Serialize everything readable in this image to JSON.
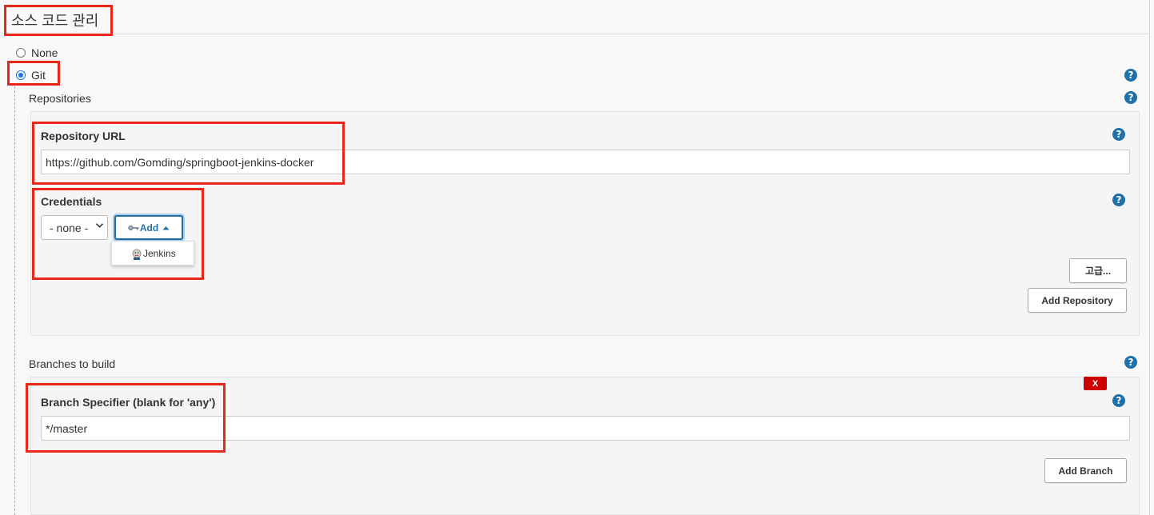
{
  "scm": {
    "title": "소스 코드 관리",
    "options": [
      {
        "label": "None",
        "selected": false
      },
      {
        "label": "Git",
        "selected": true
      }
    ]
  },
  "help_symbol": "?",
  "repositories": {
    "label": "Repositories",
    "repository_url_label": "Repository URL",
    "repository_url_value": "https://github.com/Gomding/springboot-jenkins-docker",
    "credentials_label": "Credentials",
    "credentials_selected": "- none -",
    "add_button_label": "Add",
    "add_dropdown_items": [
      "Jenkins"
    ],
    "advanced_button_label": "고급...",
    "add_repository_label": "Add Repository"
  },
  "branches": {
    "label": "Branches to build",
    "delete_label": "X",
    "specifier_label": "Branch Specifier (blank for 'any')",
    "specifier_value": "*/master",
    "add_branch_label": "Add Branch"
  },
  "colors": {
    "highlight": "#e8261a",
    "help_icon": "#1f6fa8",
    "delete_button": "#cc0000",
    "background": "#f8f8f8"
  }
}
